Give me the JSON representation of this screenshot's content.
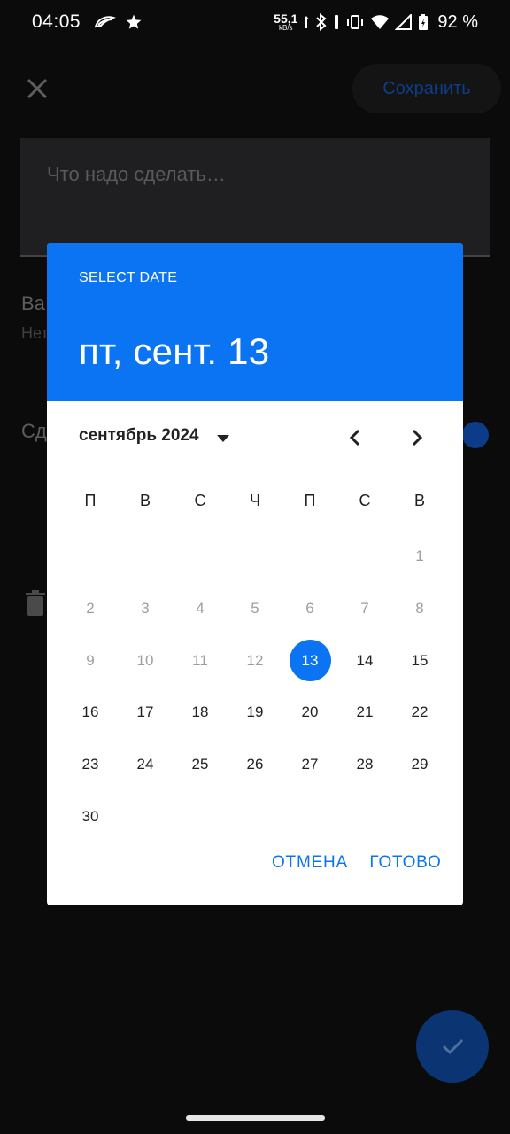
{
  "status_bar": {
    "time": "04:05",
    "net_speed": "55,1",
    "net_unit": "kB/s",
    "battery": "92 %"
  },
  "background": {
    "save_label": "Сохранить",
    "task_placeholder": "Что надо сделать…",
    "row1_label": "Ва",
    "row1_value": "Нет",
    "row2_label": "Сд"
  },
  "dialog": {
    "label": "SELECT DATE",
    "selected_date": "пт, сент. 13",
    "month_year": "сентябрь 2024",
    "weekdays": [
      "П",
      "В",
      "С",
      "Ч",
      "П",
      "С",
      "В"
    ],
    "weeks": [
      [
        "",
        "",
        "",
        "",
        "",
        "",
        "1"
      ],
      [
        "2",
        "3",
        "4",
        "5",
        "6",
        "7",
        "8"
      ],
      [
        "9",
        "10",
        "11",
        "12",
        "13",
        "14",
        "15"
      ],
      [
        "16",
        "17",
        "18",
        "19",
        "20",
        "21",
        "22"
      ],
      [
        "23",
        "24",
        "25",
        "26",
        "27",
        "28",
        "29"
      ],
      [
        "30",
        "",
        "",
        "",
        "",
        "",
        ""
      ]
    ],
    "selected_day": "13",
    "cancel_label": "ОТМЕНА",
    "done_label": "ГОТОВО"
  },
  "colors": {
    "accent": "#0a74f3",
    "overlay_bg": "#0b0b0b"
  }
}
